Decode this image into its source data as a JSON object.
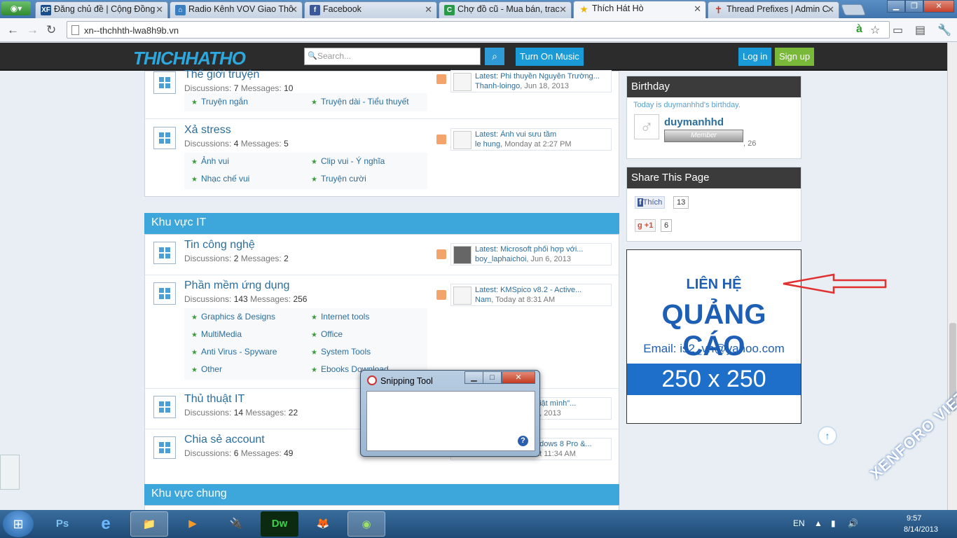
{
  "browser": {
    "tabs": [
      {
        "label": "Đăng chủ đề | Cộng Đồng",
        "favicon_text": "XF",
        "favicon_color": "#1b4f8c"
      },
      {
        "label": "Radio Kênh VOV Giao Thô",
        "favicon_text": "⌂",
        "favicon_color": "#3c7fc1"
      },
      {
        "label": "Facebook",
        "favicon_text": "f",
        "favicon_color": "#3b5998"
      },
      {
        "label": "Chợ đồ cũ - Mua bán, trac",
        "favicon_text": "C",
        "favicon_color": "#2a9a4a"
      },
      {
        "label": "Thích Hát Hò",
        "favicon_text": "★",
        "favicon_color": "#f0b400"
      },
      {
        "label": "Thread Prefixes | Admin C",
        "favicon_text": "✝",
        "favicon_color": "#c0392b"
      }
    ],
    "url": "xn--thchhth-lwa8h9b.vn"
  },
  "site": {
    "logo": "THICHHATHO",
    "search_placeholder": "Search...",
    "turn_on_music": "Turn On Music",
    "login": "Log in",
    "signup": "Sign up"
  },
  "forum": {
    "node_top": {
      "title": "Thế giới truyện",
      "stats": {
        "disc_label": "Discussions:",
        "disc": "7",
        "msg_label": "Messages:",
        "msg": "10"
      },
      "subforums": [
        "Truyện ngắn",
        "Truyện dài - Tiểu thuyết"
      ],
      "latest": {
        "text": "Latest: Phi thuyền Nguyễn Trường...",
        "user": "Thanh-loingo",
        "date": ", Jun 18, 2013"
      }
    },
    "node_xastress": {
      "title": "Xả stress",
      "stats": {
        "disc_label": "Discussions:",
        "disc": "4",
        "msg_label": "Messages:",
        "msg": "5"
      },
      "subforums": [
        "Ảnh vui",
        "Clip vui - Ý nghĩa",
        "Nhạc chế vui",
        "Truyện cười"
      ],
      "latest": {
        "text": "Latest: Ảnh vui sưu tầm",
        "user": "le hung",
        "date": ", Monday at 2:27 PM"
      }
    },
    "cat_it": "Khu vực IT",
    "node_tincongnghe": {
      "title": "Tin công nghệ",
      "stats": {
        "disc_label": "Discussions:",
        "disc": "2",
        "msg_label": "Messages:",
        "msg": "2"
      },
      "latest": {
        "text": "Latest: Microsoft phối hợp với...",
        "user": "boy_laphaichoi",
        "date": ", Jun 6, 2013"
      }
    },
    "node_phanmem": {
      "title": "Phần mềm ứng dụng",
      "stats": {
        "disc_label": "Discussions:",
        "disc": "143",
        "msg_label": "Messages:",
        "msg": "256"
      },
      "subforums": [
        "Graphics & Designs",
        "Internet tools",
        "MultiMedia",
        "Office",
        "Anti Virus - Spyware",
        "System Tools",
        "Other",
        "Ebooks Download"
      ],
      "latest": {
        "text": "Latest: KMSpico v8.2 - Active...",
        "user": "Nam",
        "date": ", Today at 8:31 AM"
      }
    },
    "node_thuthuat": {
      "title": "Thủ thuật IT",
      "stats": {
        "disc_label": "Discussions:",
        "disc": "14",
        "msg_label": "Messages:",
        "msg": "22"
      },
      "latest": {
        "text": "giật mình\"...",
        "date": "9, 2013"
      }
    },
    "node_chiase": {
      "title": "Chia sẻ account",
      "stats": {
        "disc_label": "Discussions:",
        "disc": "6",
        "msg_label": "Messages:",
        "msg": "49"
      },
      "latest": {
        "text": "ndows 8 Pro &...",
        "date": "at 11:34 AM"
      }
    },
    "cat_chung": "Khu vực chung"
  },
  "sidebar": {
    "birthday": {
      "title": "Birthday",
      "note": "Today is duymanhhd's birthday.",
      "user": "duymanhhd",
      "badge": "Member",
      "age": ", 26"
    },
    "share": {
      "title": "Share This Page",
      "fb_label": "Thích",
      "fb_count": "13",
      "gplus_label": "+1",
      "gplus_count": "6"
    },
    "ad": {
      "line1": "LIÊN HỆ",
      "line2": "QUẢNG CÁO",
      "email": "Email: is2_vn@yahoo.com",
      "size": "250 x 250"
    }
  },
  "snipping_tool": {
    "title": "Snipping Tool",
    "help": "?"
  },
  "taskbar": {
    "apps": [
      "Ps",
      "e",
      "📁",
      "▶",
      "🔌",
      "Dw",
      "🦊",
      "◉"
    ],
    "lang": "EN",
    "time": "9:57",
    "date": "8/14/2013"
  },
  "watermark": "XENFORO VIET NAM"
}
